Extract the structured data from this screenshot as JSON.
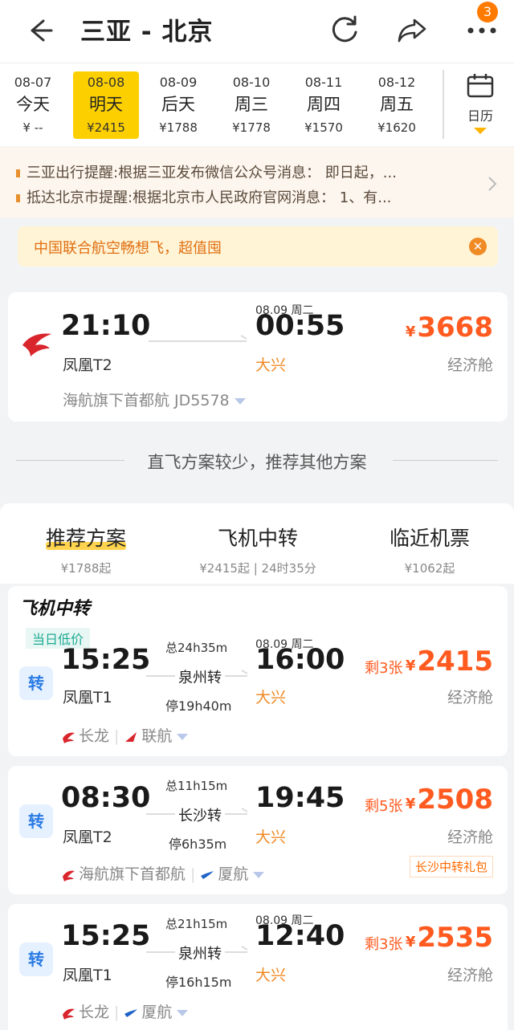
{
  "header": {
    "title": "三亚 - 北京",
    "badge": "3"
  },
  "dates": [
    {
      "date": "08-07",
      "week": "今天",
      "price": "¥ --"
    },
    {
      "date": "08-08",
      "week": "明天",
      "price": "¥2415"
    },
    {
      "date": "08-09",
      "week": "后天",
      "price": "¥1788"
    },
    {
      "date": "08-10",
      "week": "周三",
      "price": "¥1778"
    },
    {
      "date": "08-11",
      "week": "周四",
      "price": "¥1570"
    },
    {
      "date": "08-12",
      "week": "周五",
      "price": "¥1620"
    }
  ],
  "calendar_label": "日历",
  "notices": [
    "三亚出行提醒:根据三亚发布微信公众号消息： 即日起，...",
    "抵达北京市提醒:根据北京市人民政府官网消息： 1、有..."
  ],
  "promo": "中国联合航空畅想飞，超值囤",
  "direct_flight": {
    "dep_time": "21:10",
    "dep_terminal": "凤凰T2",
    "arr_time": "00:55",
    "arr_date": "08.09 周二",
    "arr_airport": "大兴",
    "price": "3668",
    "yen": "¥",
    "cabin": "经济舱",
    "airline": "海航旗下首都航 JD5578"
  },
  "divider_text": "直飞方案较少，推荐其他方案",
  "tabs": [
    {
      "label": "推荐方案",
      "sub": "¥1788起"
    },
    {
      "label": "飞机中转",
      "sub": "¥2415起 | 24时35分"
    },
    {
      "label": "临近机票",
      "sub": "¥1062起"
    }
  ],
  "transfer_section_title": "飞机中转",
  "low_tag": "当日低价",
  "transfer_badge": "转",
  "transfers": [
    {
      "dep_time": "15:25",
      "dep_terminal": "凤凰T1",
      "total": "总24h35m",
      "city": "泉州转",
      "stop": "停19h40m",
      "arr_time": "16:00",
      "arr_date": "08.09 周二",
      "arr_airport": "大兴",
      "remain": "剩3张",
      "price": "2415",
      "cabin": "经济舱",
      "airline1": "长龙",
      "airline2": "联航"
    },
    {
      "dep_time": "08:30",
      "dep_terminal": "凤凰T2",
      "total": "总11h15m",
      "city": "长沙转",
      "stop": "停6h35m",
      "arr_time": "19:45",
      "arr_airport": "大兴",
      "remain": "剩5张",
      "price": "2508",
      "cabin": "经济舱",
      "airline1": "海航旗下首都航",
      "airline2": "厦航",
      "gift": "长沙中转礼包"
    },
    {
      "dep_time": "15:25",
      "dep_terminal": "凤凰T1",
      "total": "总21h15m",
      "city": "泉州转",
      "stop": "停16h15m",
      "arr_time": "12:40",
      "arr_date": "08.09 周二",
      "arr_airport": "大兴",
      "remain": "剩3张",
      "price": "2535",
      "cabin": "经济舱",
      "airline1": "长龙",
      "airline2": "厦航"
    }
  ],
  "colors": {
    "accent": "#ff5a1f",
    "selected_date": "#fcd000",
    "airport": "#f08a24"
  }
}
